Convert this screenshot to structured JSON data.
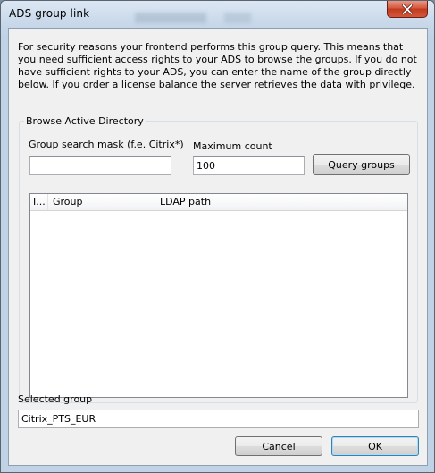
{
  "window": {
    "title": "ADS group link",
    "background_title": "Query pool"
  },
  "description": "For security reasons your frontend performs this group query. This means that you need sufficient access rights to your ADS to browse the groups. If you do not have sufficient rights to your ADS, you can enter the name of the group directly below. If you order a license balance the server retrieves the data with privilege.",
  "browse": {
    "legend": "Browse Active Directory",
    "search_mask_label": "Group search mask (f.e. Citrix*)",
    "search_mask_value": "",
    "max_count_label": "Maximum count",
    "max_count_value": "100",
    "query_button": "Query groups",
    "columns": [
      "I...",
      "Group",
      "LDAP path"
    ],
    "rows": []
  },
  "selected": {
    "label": "Selected group",
    "value": "Citrix_PTS_EUR"
  },
  "buttons": {
    "cancel": "Cancel",
    "ok": "OK"
  },
  "colors": {
    "close_button": "#c23a1e",
    "default_button_border": "#3c7fb1",
    "dialog_background": "#f0f0f0"
  },
  "icons": {
    "close": "close-icon"
  }
}
